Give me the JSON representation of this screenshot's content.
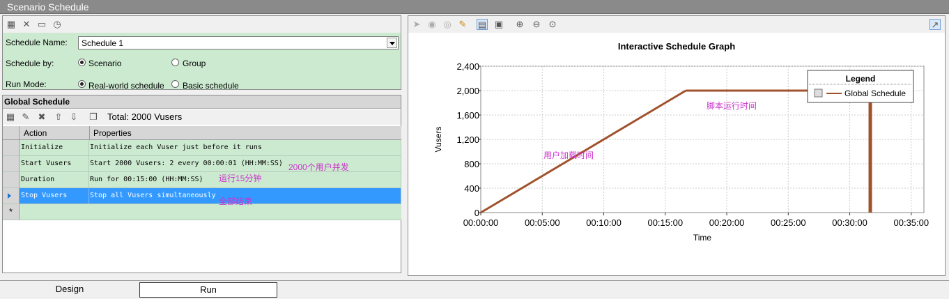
{
  "window": {
    "title": "Scenario Schedule"
  },
  "settings": {
    "schedule_name_label": "Schedule Name:",
    "schedule_name_value": "Schedule 1",
    "schedule_by_label": "Schedule by:",
    "schedule_by_options": [
      "Scenario",
      "Group"
    ],
    "schedule_by_selected": "Scenario",
    "run_mode_label": "Run Mode:",
    "run_mode_options": [
      "Real-world schedule",
      "Basic schedule"
    ],
    "run_mode_selected": "Real-world schedule"
  },
  "global_schedule": {
    "title": "Global Schedule",
    "total_label": "Total: 2000 Vusers",
    "columns": [
      "Action",
      "Properties"
    ],
    "rows": [
      {
        "action": "Initialize",
        "properties": "Initialize each Vuser just before it runs"
      },
      {
        "action": "Start  Vusers",
        "properties": "Start 2000 Vusers: 2 every 00:00:01 (HH:MM:SS)"
      },
      {
        "action": "Duration",
        "properties": "Run for 00:15:00 (HH:MM:SS)"
      },
      {
        "action": "Stop Vusers",
        "properties": "Stop all Vusers simultaneously"
      }
    ],
    "new_row_marker": "*",
    "annotations": [
      "2000个用户并发",
      "运行15分钟",
      "全部结束"
    ]
  },
  "chart_data": {
    "type": "line",
    "title": "Interactive Schedule Graph",
    "xlabel": "Time",
    "ylabel": "Vusers",
    "x_ticks": [
      "00:00:00",
      "00:05:00",
      "00:10:00",
      "00:15:00",
      "00:20:00",
      "00:25:00",
      "00:30:00",
      "00:35:00"
    ],
    "y_ticks": [
      "0",
      "400",
      "800",
      "1,200",
      "1,600",
      "2,000",
      "2,400"
    ],
    "xlim_minutes": [
      0,
      35
    ],
    "ylim": [
      0,
      2400
    ],
    "grid": true,
    "legend": {
      "title": "Legend",
      "placement": "top-right",
      "entries": [
        "Global Schedule"
      ]
    },
    "series": [
      {
        "name": "Global Schedule",
        "color": "#a0522d",
        "points_minutes": [
          [
            0,
            0
          ],
          [
            16.67,
            2000
          ],
          [
            31.67,
            2000
          ],
          [
            31.67,
            0
          ]
        ]
      }
    ],
    "annotations": [
      "用户加载时间",
      "脚本运行时间"
    ]
  },
  "tabs": [
    "Design",
    "Run"
  ],
  "active_tab": "Run"
}
